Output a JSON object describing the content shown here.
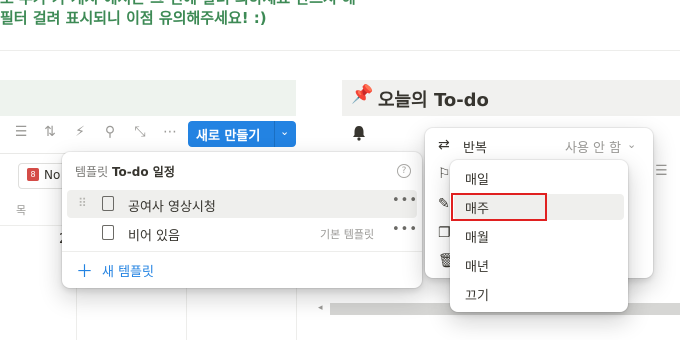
{
  "notice": {
    "line1": "로 추가 가 게시 에서는 그 번에 날려 의하세요 반드시 해",
    "line2": "필터 걸려 표시되니 이점 유의해주세요! :)"
  },
  "callout": {
    "icon": "pushpin-icon",
    "title": "오늘의 To-do"
  },
  "toolbar": {
    "icons": [
      "filter-icon",
      "sort-icon",
      "automation-icon",
      "search-icon",
      "expand-icon",
      "more-icon"
    ],
    "new_button": "새로 만들기"
  },
  "table": {
    "chip_label": "No",
    "chip_date": "8",
    "column_header": "목",
    "row_char": "2"
  },
  "template_popover": {
    "title_prefix": "템플릿",
    "title_name": "To-do 일정",
    "items": [
      {
        "label": "공여사 영상시청",
        "badge": ""
      },
      {
        "label": "비어 있음",
        "badge": "기본 템플릿"
      }
    ],
    "add_label": "새 템플릿"
  },
  "repeat_panel": {
    "label": "반복",
    "value": "사용 안 함",
    "options": [
      "매일",
      "매주",
      "매월",
      "매년",
      "끄기"
    ],
    "highlighted": "매주"
  },
  "colors": {
    "accent": "#2383e2",
    "notice": "#3d8a55",
    "highlight_box": "#e02020"
  }
}
